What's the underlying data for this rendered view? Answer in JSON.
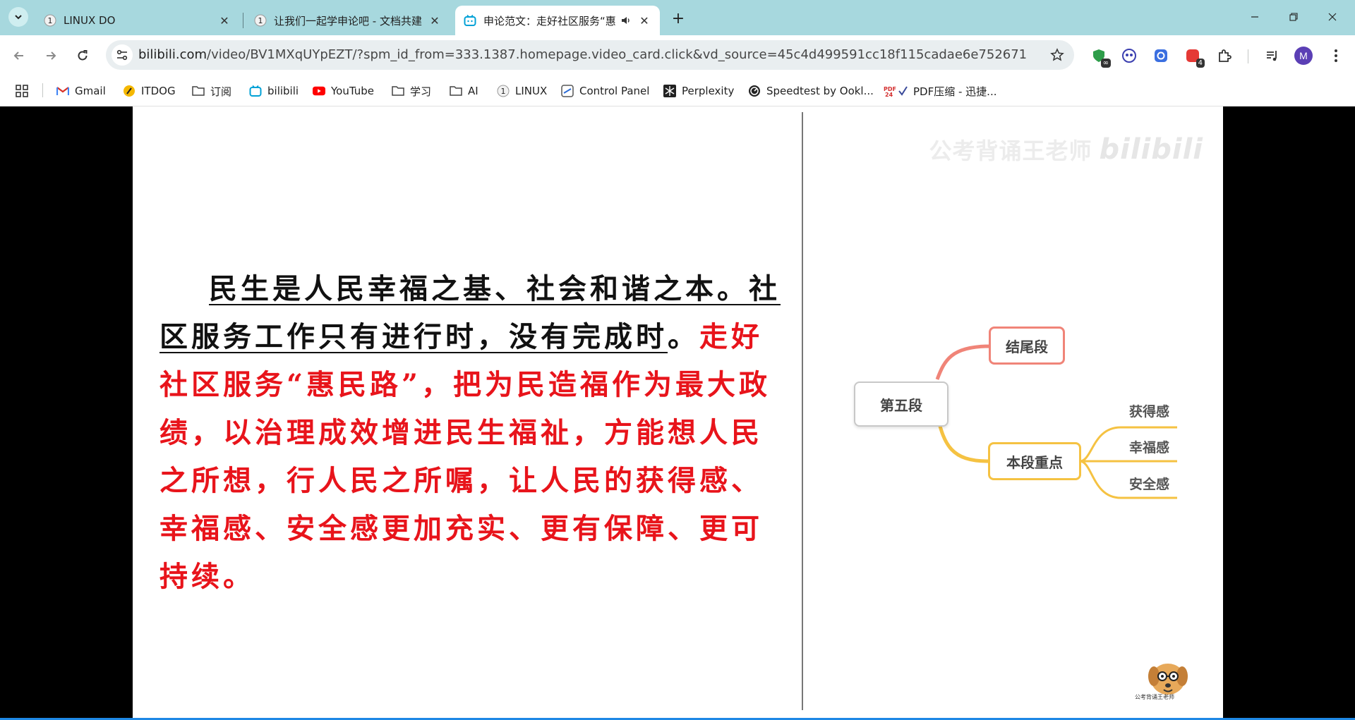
{
  "browser": {
    "tabs": [
      {
        "title": "LINUX DO",
        "active": false
      },
      {
        "title": "让我们一起学申论吧 - 文档共建",
        "active": false
      },
      {
        "title": "申论范文：走好社区服务“惠",
        "active": true
      }
    ],
    "new_tab": "+",
    "window_controls": {
      "minimize": "—",
      "restore": "❐",
      "close": "✕"
    }
  },
  "toolbar": {
    "url_host": "bilibili.com",
    "url_path": "/video/BV1MXqUYpEZT/?spm_id_from=333.1387.homepage.video_card.click&vd_source=45c4d499591cc18f115cadae6e752671",
    "extension_badges": [
      "∞",
      "4"
    ],
    "avatar_letter": "M"
  },
  "bookmarks": [
    {
      "label": "Gmail",
      "icon": "gmail-icon"
    },
    {
      "label": "ITDOG",
      "icon": "itdog-icon"
    },
    {
      "label": "订阅",
      "icon": "folder-icon"
    },
    {
      "label": "bilibili",
      "icon": "bilibili-icon"
    },
    {
      "label": "YouTube",
      "icon": "youtube-icon"
    },
    {
      "label": "学习",
      "icon": "folder-icon"
    },
    {
      "label": "AI",
      "icon": "folder-icon"
    },
    {
      "label": "LINUX",
      "icon": "linuxdo-icon"
    },
    {
      "label": "Control Panel",
      "icon": "control-panel-icon"
    },
    {
      "label": "Perplexity",
      "icon": "perplexity-icon"
    },
    {
      "label": "Speedtest by Ookl...",
      "icon": "speedtest-icon"
    },
    {
      "label": "PDF压缩 - 迅捷...",
      "icon": "pdf-icon"
    }
  ],
  "slide": {
    "essay_line1_underlined": "民生是人民幸福之基、社会和谐之本。",
    "essay_line2_underlined": "社区服务工作只有进行时，没有完成时",
    "essay_period": "。",
    "essay_red": "走好社区服务“惠民路”，把为民造福作为最大政绩，以治理成效增进民生福祉，方能想人民之所想，行人民之所嘱，让人民的获得感、幸福感、安全感更加充实、更有保障、更可持续。",
    "watermark": "公考背诵王老师",
    "watermark_brand": "bilibili",
    "mindmap": {
      "root": "第五段",
      "branch_top": "结尾段",
      "branch_bottom": "本段重点",
      "leaves": [
        "获得感",
        "幸福感",
        "安全感"
      ],
      "colors": {
        "top": "#f08478",
        "bottom": "#f5c242"
      }
    },
    "logo_caption": "公考背诵王老师"
  }
}
